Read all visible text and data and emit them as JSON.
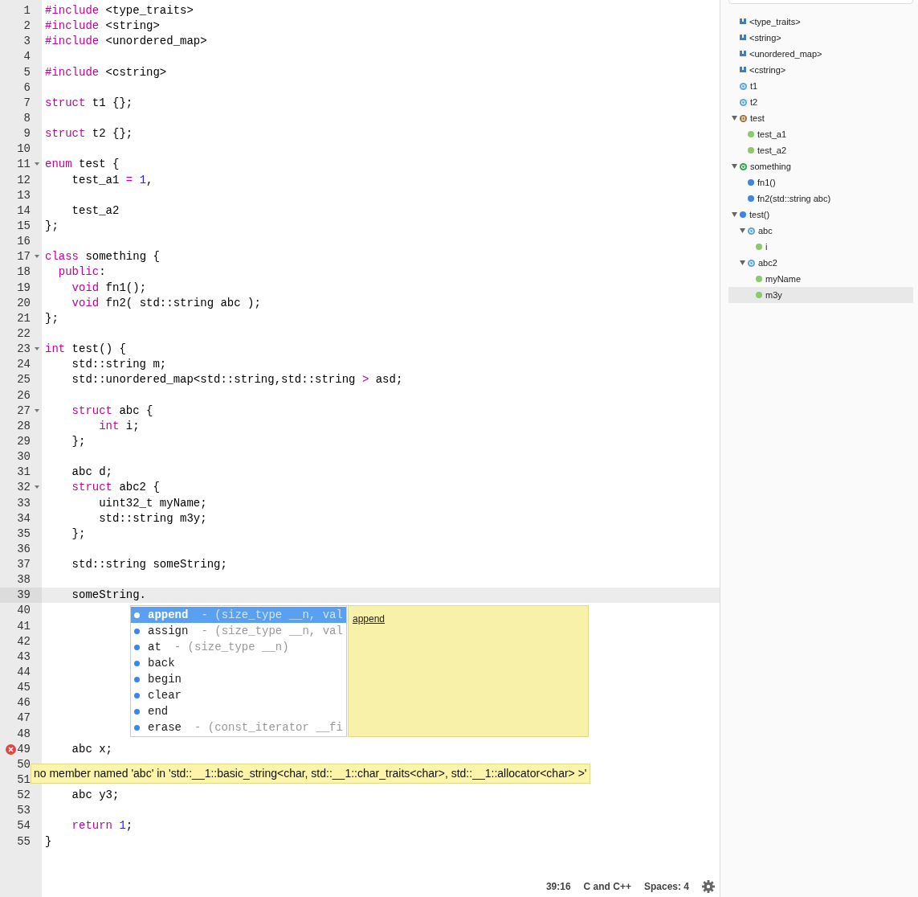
{
  "editor": {
    "lines": [
      {
        "number": "1",
        "fold": false,
        "current": false,
        "error": false,
        "tokens": [
          {
            "kind": "keyword",
            "text": "#include"
          },
          {
            "kind": "plain",
            "text": " <type_traits>"
          }
        ]
      },
      {
        "number": "2",
        "fold": false,
        "current": false,
        "error": false,
        "tokens": [
          {
            "kind": "keyword",
            "text": "#include"
          },
          {
            "kind": "plain",
            "text": " <string>"
          }
        ]
      },
      {
        "number": "3",
        "fold": false,
        "current": false,
        "error": false,
        "tokens": [
          {
            "kind": "keyword",
            "text": "#include"
          },
          {
            "kind": "plain",
            "text": " <unordered_map>"
          }
        ]
      },
      {
        "number": "4",
        "fold": false,
        "current": false,
        "error": false
      },
      {
        "number": "5",
        "fold": false,
        "current": false,
        "error": false,
        "tokens": [
          {
            "kind": "keyword",
            "text": "#include"
          },
          {
            "kind": "plain",
            "text": " <cstring>"
          }
        ]
      },
      {
        "number": "6",
        "fold": false,
        "current": false,
        "error": false
      },
      {
        "number": "7",
        "fold": false,
        "current": false,
        "error": false,
        "tokens": [
          {
            "kind": "keyword",
            "text": "struct"
          },
          {
            "kind": "plain",
            "text": " t1 {};"
          }
        ]
      },
      {
        "number": "8",
        "fold": false,
        "current": false,
        "error": false
      },
      {
        "number": "9",
        "fold": false,
        "current": false,
        "error": false,
        "tokens": [
          {
            "kind": "keyword",
            "text": "struct"
          },
          {
            "kind": "plain",
            "text": " t2 {};"
          }
        ]
      },
      {
        "number": "10",
        "fold": false,
        "current": false,
        "error": false
      },
      {
        "number": "11",
        "fold": true,
        "current": false,
        "error": false,
        "tokens": [
          {
            "kind": "keyword",
            "text": "enum"
          },
          {
            "kind": "plain",
            "text": " test {"
          }
        ]
      },
      {
        "number": "12",
        "fold": false,
        "current": false,
        "error": false,
        "tokens": [
          {
            "kind": "plain",
            "text": "    test_a1 "
          },
          {
            "kind": "operator",
            "text": "="
          },
          {
            "kind": "number",
            "text": " 1"
          },
          {
            "kind": "plain",
            "text": ","
          }
        ]
      },
      {
        "number": "13",
        "fold": false,
        "current": false,
        "error": false
      },
      {
        "number": "14",
        "fold": false,
        "current": false,
        "error": false,
        "tokens": [
          {
            "kind": "plain",
            "text": "    test_a2"
          }
        ]
      },
      {
        "number": "15",
        "fold": false,
        "current": false,
        "error": false,
        "tokens": [
          {
            "kind": "plain",
            "text": "};"
          }
        ]
      },
      {
        "number": "16",
        "fold": false,
        "current": false,
        "error": false
      },
      {
        "number": "17",
        "fold": true,
        "current": false,
        "error": false,
        "tokens": [
          {
            "kind": "keyword",
            "text": "class"
          },
          {
            "kind": "plain",
            "text": " something {"
          }
        ]
      },
      {
        "number": "18",
        "fold": false,
        "current": false,
        "error": false,
        "tokens": [
          {
            "kind": "keyword",
            "text": "  public"
          },
          {
            "kind": "plain",
            "text": ":"
          }
        ]
      },
      {
        "number": "19",
        "fold": false,
        "current": false,
        "error": false,
        "tokens": [
          {
            "kind": "keyword",
            "text": "    void"
          },
          {
            "kind": "plain",
            "text": " fn1();"
          }
        ]
      },
      {
        "number": "20",
        "fold": false,
        "current": false,
        "error": false,
        "tokens": [
          {
            "kind": "keyword",
            "text": "    void"
          },
          {
            "kind": "plain",
            "text": " fn2( std::string abc );"
          }
        ]
      },
      {
        "number": "21",
        "fold": false,
        "current": false,
        "error": false,
        "tokens": [
          {
            "kind": "plain",
            "text": "};"
          }
        ]
      },
      {
        "number": "22",
        "fold": false,
        "current": false,
        "error": false
      },
      {
        "number": "23",
        "fold": true,
        "current": false,
        "error": false,
        "tokens": [
          {
            "kind": "keyword",
            "text": "int"
          },
          {
            "kind": "plain",
            "text": " test() {"
          }
        ]
      },
      {
        "number": "24",
        "fold": false,
        "current": false,
        "error": false,
        "tokens": [
          {
            "kind": "plain",
            "text": "    std::string m;"
          }
        ]
      },
      {
        "number": "25",
        "fold": false,
        "current": false,
        "error": false,
        "tokens": [
          {
            "kind": "plain",
            "text": "    std::unordered_map<std::string,std::string "
          },
          {
            "kind": "operator",
            "text": ">"
          },
          {
            "kind": "plain",
            "text": " asd;"
          }
        ]
      },
      {
        "number": "26",
        "fold": false,
        "current": false,
        "error": false
      },
      {
        "number": "27",
        "fold": true,
        "current": false,
        "error": false,
        "tokens": [
          {
            "kind": "keyword",
            "text": "    struct"
          },
          {
            "kind": "plain",
            "text": " abc {"
          }
        ]
      },
      {
        "number": "28",
        "fold": false,
        "current": false,
        "error": false,
        "tokens": [
          {
            "kind": "keyword",
            "text": "        int"
          },
          {
            "kind": "plain",
            "text": " i;"
          }
        ]
      },
      {
        "number": "29",
        "fold": false,
        "current": false,
        "error": false,
        "tokens": [
          {
            "kind": "plain",
            "text": "    };"
          }
        ]
      },
      {
        "number": "30",
        "fold": false,
        "current": false,
        "error": false
      },
      {
        "number": "31",
        "fold": false,
        "current": false,
        "error": false,
        "tokens": [
          {
            "kind": "plain",
            "text": "    abc d;"
          }
        ]
      },
      {
        "number": "32",
        "fold": true,
        "current": false,
        "error": false,
        "tokens": [
          {
            "kind": "keyword",
            "text": "    struct"
          },
          {
            "kind": "plain",
            "text": " abc2 {"
          }
        ]
      },
      {
        "number": "33",
        "fold": false,
        "current": false,
        "error": false,
        "tokens": [
          {
            "kind": "plain",
            "text": "        uint32_t myName;"
          }
        ]
      },
      {
        "number": "34",
        "fold": false,
        "current": false,
        "error": false,
        "tokens": [
          {
            "kind": "plain",
            "text": "        std::string m3y;"
          }
        ]
      },
      {
        "number": "35",
        "fold": false,
        "current": false,
        "error": false,
        "tokens": [
          {
            "kind": "plain",
            "text": "    };"
          }
        ]
      },
      {
        "number": "36",
        "fold": false,
        "current": false,
        "error": false
      },
      {
        "number": "37",
        "fold": false,
        "current": false,
        "error": false,
        "tokens": [
          {
            "kind": "plain",
            "text": "    std::string someString;"
          }
        ]
      },
      {
        "number": "38",
        "fold": false,
        "current": false,
        "error": false
      },
      {
        "number": "39",
        "fold": false,
        "current": true,
        "error": false,
        "tokens": [
          {
            "kind": "plain",
            "text": "    someString."
          }
        ]
      },
      {
        "number": "40",
        "fold": false,
        "current": false,
        "error": false
      },
      {
        "number": "41",
        "fold": false,
        "current": false,
        "error": false
      },
      {
        "number": "42",
        "fold": false,
        "current": false,
        "error": false
      },
      {
        "number": "43",
        "fold": false,
        "current": false,
        "error": false
      },
      {
        "number": "44",
        "fold": false,
        "current": false,
        "error": false
      },
      {
        "number": "45",
        "fold": false,
        "current": false,
        "error": false
      },
      {
        "number": "46",
        "fold": false,
        "current": false,
        "error": false
      },
      {
        "number": "47",
        "fold": false,
        "current": false,
        "error": false
      },
      {
        "number": "48",
        "fold": false,
        "current": false,
        "error": false
      },
      {
        "number": "49",
        "fold": false,
        "current": false,
        "error": true,
        "tokens": [
          {
            "kind": "plain",
            "text": "    abc x;"
          }
        ]
      },
      {
        "number": "50",
        "current": false,
        "error": false
      },
      {
        "number": "51",
        "current": false,
        "error": false
      },
      {
        "number": "52",
        "fold": false,
        "current": false,
        "error": false,
        "tokens": [
          {
            "kind": "plain",
            "text": "    abc y3;"
          }
        ]
      },
      {
        "number": "53",
        "fold": false,
        "current": false,
        "error": false
      },
      {
        "number": "54",
        "fold": false,
        "current": false,
        "error": false,
        "tokens": [
          {
            "kind": "keyword",
            "text": "    return"
          },
          {
            "kind": "number",
            "text": " 1"
          },
          {
            "kind": "plain",
            "text": ";"
          }
        ]
      },
      {
        "number": "55",
        "fold": false,
        "current": false,
        "error": false,
        "tokens": [
          {
            "kind": "plain",
            "text": "}"
          }
        ]
      }
    ],
    "autocomplete": {
      "items": [
        {
          "name": "append",
          "detail": "- (size_type __n, val",
          "selected": true
        },
        {
          "name": "assign",
          "detail": "- (size_type __n, val",
          "selected": false
        },
        {
          "name": "at",
          "detail": "- (size_type __n)",
          "selected": false
        },
        {
          "name": "back",
          "selected": false
        },
        {
          "name": "begin",
          "selected": false
        },
        {
          "name": "clear",
          "selected": false
        },
        {
          "name": "end",
          "selected": false
        },
        {
          "name": "erase",
          "detail": "- (const_iterator __fi",
          "selected": false
        }
      ],
      "doc_link": "append"
    },
    "error_tooltip": "no member named 'abc' in 'std::__1::basic_string<char, std::__1::char_traits<char>, std::__1::allocator<char> >'"
  },
  "status_bar": {
    "position": "39:16",
    "language": "C and C++",
    "indent": "Spaces: 4"
  },
  "outline": {
    "items": [
      {
        "label": "<type_traits>",
        "kind": "include",
        "selected": false
      },
      {
        "label": "<string>",
        "kind": "include",
        "selected": false
      },
      {
        "label": "<unordered_map>",
        "kind": "include",
        "selected": false
      },
      {
        "label": "<cstring>",
        "kind": "include",
        "selected": false
      },
      {
        "label": "t1",
        "kind": "struct",
        "selected": false
      },
      {
        "label": "t2",
        "kind": "struct",
        "selected": false
      },
      {
        "label": "test",
        "kind": "enum",
        "selected": false,
        "expanded": true,
        "children": [
          {
            "label": "test_a1",
            "kind": "member",
            "selected": false
          },
          {
            "label": "test_a2",
            "kind": "member",
            "selected": false
          }
        ]
      },
      {
        "label": "something",
        "kind": "class",
        "selected": false,
        "expanded": true,
        "children": [
          {
            "label": "fn1()",
            "kind": "method",
            "selected": false
          },
          {
            "label": "fn2(std::string abc)",
            "kind": "method",
            "selected": false
          }
        ]
      },
      {
        "label": "test()",
        "kind": "method",
        "selected": false,
        "expanded": true,
        "children": [
          {
            "label": "abc",
            "kind": "struct",
            "selected": false,
            "expanded": true,
            "children": [
              {
                "label": "i",
                "kind": "member",
                "selected": false
              }
            ]
          },
          {
            "label": "abc2",
            "kind": "struct",
            "selected": false,
            "expanded": true,
            "children": [
              {
                "label": "myName",
                "kind": "member",
                "selected": false
              },
              {
                "label": "m3y",
                "kind": "member",
                "selected": true
              }
            ]
          }
        ]
      }
    ]
  }
}
